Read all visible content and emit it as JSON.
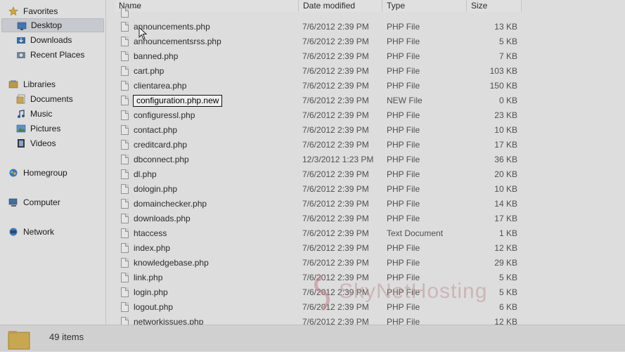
{
  "nav": {
    "favorites": "Favorites",
    "desktop": "Desktop",
    "downloads": "Downloads",
    "recent_places": "Recent Places",
    "libraries": "Libraries",
    "documents": "Documents",
    "music": "Music",
    "pictures": "Pictures",
    "videos": "Videos",
    "homegroup": "Homegroup",
    "computer": "Computer",
    "network": "Network"
  },
  "columns": {
    "name": "Name",
    "date": "Date modified",
    "type": "Type",
    "size": "Size"
  },
  "files": [
    {
      "name": "announcements.php",
      "date": "7/6/2012 2:39 PM",
      "type": "PHP File",
      "size": "13 KB"
    },
    {
      "name": "announcementsrss.php",
      "date": "7/6/2012 2:39 PM",
      "type": "PHP File",
      "size": "5 KB"
    },
    {
      "name": "banned.php",
      "date": "7/6/2012 2:39 PM",
      "type": "PHP File",
      "size": "7 KB"
    },
    {
      "name": "cart.php",
      "date": "7/6/2012 2:39 PM",
      "type": "PHP File",
      "size": "103 KB"
    },
    {
      "name": "clientarea.php",
      "date": "7/6/2012 2:39 PM",
      "type": "PHP File",
      "size": "150 KB"
    },
    {
      "name": "configuration.php.new",
      "date": "7/6/2012 2:39 PM",
      "type": "NEW File",
      "size": "0 KB"
    },
    {
      "name": "configuressl.php",
      "date": "7/6/2012 2:39 PM",
      "type": "PHP File",
      "size": "23 KB"
    },
    {
      "name": "contact.php",
      "date": "7/6/2012 2:39 PM",
      "type": "PHP File",
      "size": "10 KB"
    },
    {
      "name": "creditcard.php",
      "date": "7/6/2012 2:39 PM",
      "type": "PHP File",
      "size": "17 KB"
    },
    {
      "name": "dbconnect.php",
      "date": "12/3/2012 1:23 PM",
      "type": "PHP File",
      "size": "36 KB"
    },
    {
      "name": "dl.php",
      "date": "7/6/2012 2:39 PM",
      "type": "PHP File",
      "size": "20 KB"
    },
    {
      "name": "dologin.php",
      "date": "7/6/2012 2:39 PM",
      "type": "PHP File",
      "size": "10 KB"
    },
    {
      "name": "domainchecker.php",
      "date": "7/6/2012 2:39 PM",
      "type": "PHP File",
      "size": "14 KB"
    },
    {
      "name": "downloads.php",
      "date": "7/6/2012 2:39 PM",
      "type": "PHP File",
      "size": "17 KB"
    },
    {
      "name": "htaccess",
      "date": "7/6/2012 2:39 PM",
      "type": "Text Document",
      "size": "1 KB"
    },
    {
      "name": "index.php",
      "date": "7/6/2012 2:39 PM",
      "type": "PHP File",
      "size": "12 KB"
    },
    {
      "name": "knowledgebase.php",
      "date": "7/6/2012 2:39 PM",
      "type": "PHP File",
      "size": "29 KB"
    },
    {
      "name": "link.php",
      "date": "7/6/2012 2:39 PM",
      "type": "PHP File",
      "size": "5 KB"
    },
    {
      "name": "login.php",
      "date": "7/6/2012 2:39 PM",
      "type": "PHP File",
      "size": "5 KB"
    },
    {
      "name": "logout.php",
      "date": "7/6/2012 2:39 PM",
      "type": "PHP File",
      "size": "6 KB"
    },
    {
      "name": "networkissues.php",
      "date": "7/6/2012 2:39 PM",
      "type": "PHP File",
      "size": "12 KB"
    }
  ],
  "rename_value": "configuration.php.new",
  "watermark": "SkyNetHosting",
  "status": {
    "count": "49 items"
  },
  "colors": {
    "accent": "#c9a0a8",
    "selection": "#d3d6db"
  }
}
